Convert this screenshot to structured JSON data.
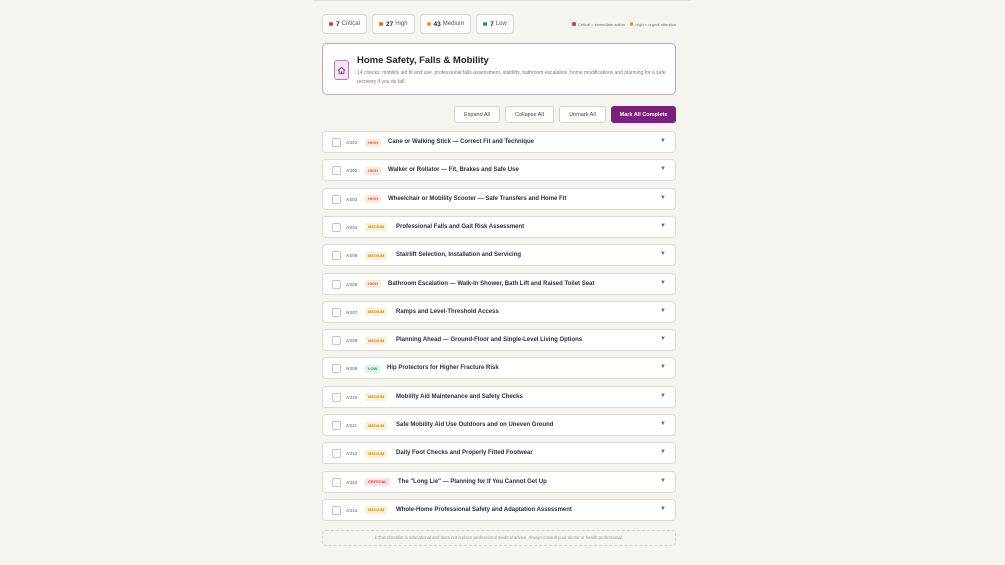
{
  "summary": {
    "pills": [
      {
        "count": "7",
        "label": "Critical",
        "color": "#d33a3a"
      },
      {
        "count": "27",
        "label": "High",
        "color": "#e06a2a"
      },
      {
        "count": "43",
        "label": "Medium",
        "color": "#e0a018"
      },
      {
        "count": "7",
        "label": "Low",
        "color": "#2f9a55"
      }
    ],
    "legend": [
      {
        "label": "Critical = immediate action",
        "color": "#d33a3a"
      },
      {
        "label": "High = urgent attention",
        "color": "#e0a018"
      }
    ]
  },
  "header": {
    "icon": "home-icon",
    "title": "Home Safety, Falls & Mobility",
    "description": "14 checks: mobility aid fit and use, professional falls assessment, stairlifts, bathroom escalation, home modifications and planning for a safe recovery if you do fall."
  },
  "actions": {
    "expand_all": "Expand All",
    "collapse_all": "Collapse All",
    "unmark_all": "Unmark All",
    "mark_all_complete": "Mark All Complete"
  },
  "items": [
    {
      "code": "AS01",
      "priority": "high",
      "priority_label": "HIGH",
      "title": "Cane or Walking Stick — Correct Fit and Technique"
    },
    {
      "code": "AS02",
      "priority": "high",
      "priority_label": "HIGH",
      "title": "Walker or Rollator — Fit, Brakes and Safe Use"
    },
    {
      "code": "AS03",
      "priority": "high",
      "priority_label": "HIGH",
      "title": "Wheelchair or Mobility Scooter — Safe Transfers and Home Fit"
    },
    {
      "code": "AS04",
      "priority": "medium",
      "priority_label": "MEDIUM",
      "title": "Professional Falls and Gait Risk Assessment"
    },
    {
      "code": "AS05",
      "priority": "medium",
      "priority_label": "MEDIUM",
      "title": "Stairlift Selection, Installation and Servicing"
    },
    {
      "code": "AS06",
      "priority": "high",
      "priority_label": "HIGH",
      "title": "Bathroom Escalation — Walk-In Shower, Bath Lift and Raised Toilet Seat"
    },
    {
      "code": "AS07",
      "priority": "medium",
      "priority_label": "MEDIUM",
      "title": "Ramps and Level-Threshold Access"
    },
    {
      "code": "AS08",
      "priority": "medium",
      "priority_label": "MEDIUM",
      "title": "Planning Ahead — Ground-Floor and Single-Level Living Options"
    },
    {
      "code": "AS09",
      "priority": "low",
      "priority_label": "LOW",
      "title": "Hip Protectors for Higher Fracture Risk"
    },
    {
      "code": "AS10",
      "priority": "medium",
      "priority_label": "MEDIUM",
      "title": "Mobility Aid Maintenance and Safety Checks"
    },
    {
      "code": "AS11",
      "priority": "medium",
      "priority_label": "MEDIUM",
      "title": "Safe Mobility Aid Use Outdoors and on Uneven Ground"
    },
    {
      "code": "AS12",
      "priority": "medium",
      "priority_label": "MEDIUM",
      "title": "Daily Foot Checks and Properly Fitted Footwear"
    },
    {
      "code": "AS13",
      "priority": "critical",
      "priority_label": "CRITICAL",
      "title": "The \"Long Lie\" — Planning for If You Cannot Get Up"
    },
    {
      "code": "AS14",
      "priority": "medium",
      "priority_label": "MEDIUM",
      "title": "Whole-Home Professional Safety and Adaptation Assessment"
    }
  ],
  "disclaimer": "ℹ This checklist is educational and does not replace professional medical advice. Always consult your doctor or health professional."
}
